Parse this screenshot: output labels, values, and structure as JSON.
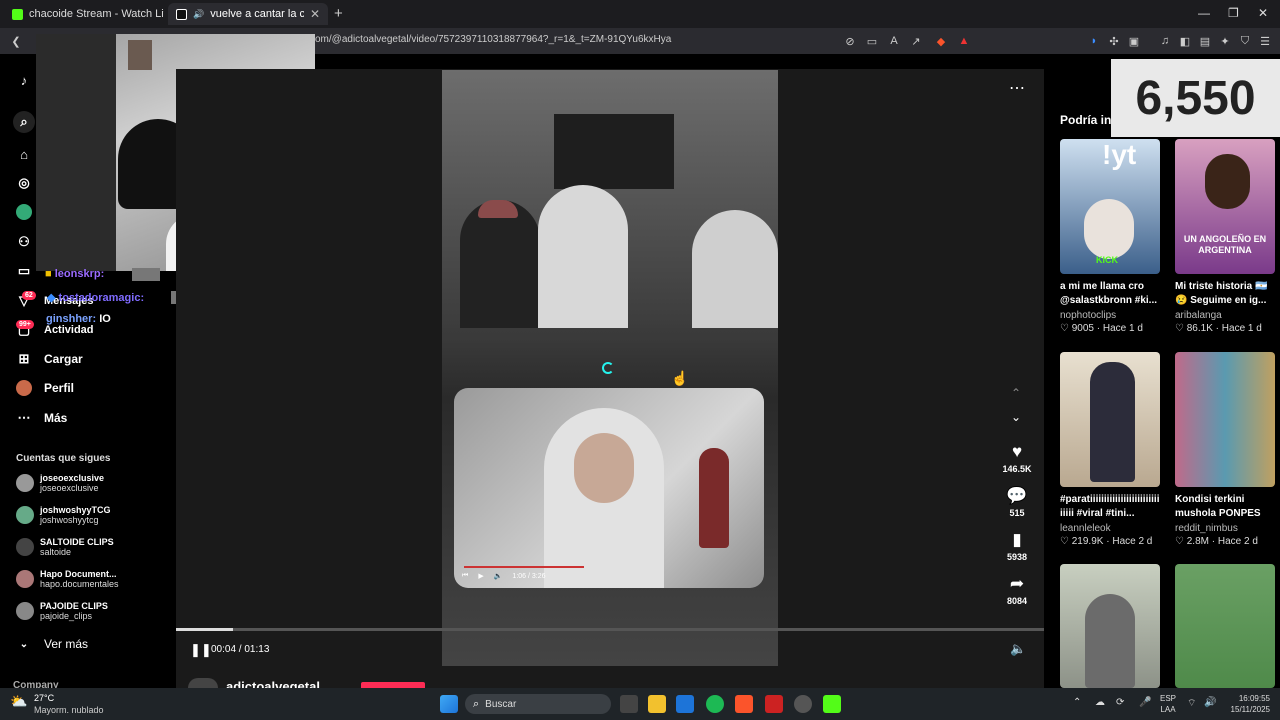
{
  "tabs": [
    {
      "title": "chacoide Stream - Watch Live on",
      "favicon_color": "#53fc18"
    },
    {
      "title": "vuelve a cantar la chica? Jajaj",
      "favicon_color": "#000000"
    }
  ],
  "browser": {
    "url": "om/@adictoalvegetal/video/7572397110318877964?_r=1&_t=ZM-91QYu6kxHya",
    "window_controls": {
      "minimize": "—",
      "maximize": "❐",
      "close": "✕"
    },
    "new_tab": "+"
  },
  "sidebar": {
    "nav": [
      {
        "label": "",
        "icon": "tiktok-logo-icon"
      },
      {
        "label": "",
        "icon": "search-icon"
      },
      {
        "label": "",
        "icon": "home-icon"
      },
      {
        "label": "",
        "icon": "compass-icon"
      },
      {
        "label": "",
        "icon": "following-avatar-icon"
      },
      {
        "label": "",
        "icon": "friends-icon"
      },
      {
        "label": "",
        "icon": "live-icon"
      },
      {
        "label": "Mensajes",
        "icon": "messages-icon",
        "badge": "62"
      },
      {
        "label": "Actividad",
        "icon": "activity-icon",
        "badge": "99+"
      },
      {
        "label": "Cargar",
        "icon": "upload-icon"
      },
      {
        "label": "Perfil",
        "icon": "profile-icon"
      },
      {
        "label": "Más",
        "icon": "more-icon"
      }
    ],
    "following_title": "Cuentas que sigues",
    "following": [
      {
        "name": "joseoexclusive",
        "handle": "joseoexclusive"
      },
      {
        "name": "joshwoshyyTCG",
        "handle": "joshwoshyytcg"
      },
      {
        "name": "SALTOIDE CLIPS",
        "handle": "saltoide"
      },
      {
        "name": "Hapo Document...",
        "handle": "hapo.documentales"
      },
      {
        "name": "PAJOIDE CLIPS",
        "handle": "pajoide_clips"
      }
    ],
    "see_more": "Ver más",
    "company": "Company"
  },
  "chat": [
    {
      "user": "leonskrp:",
      "message": "",
      "color": "#9b6bff"
    },
    {
      "user": "tostadoramagic:",
      "message": "",
      "color": "#7f6bff"
    },
    {
      "user": "ginshher:",
      "message": "IO",
      "color": "#7aa2ff"
    }
  ],
  "video": {
    "time_current": "00:04",
    "time_total": "01:13",
    "progress": 0.066,
    "inner_time": "1:06 / 3:26",
    "author": "adictoalvegetal",
    "actions": [
      {
        "icon": "heart-icon",
        "count": "146.5K"
      },
      {
        "icon": "comment-icon",
        "count": "515"
      },
      {
        "icon": "bookmark-icon",
        "count": "5938"
      },
      {
        "icon": "share-icon",
        "count": "8084"
      }
    ]
  },
  "viewer_count": "6,550",
  "recommend": {
    "title": "Podría in",
    "cards": [
      {
        "title": "a mi me llama cro @salastkbronn #ki...",
        "user": "nophotoclips",
        "likes": "9005",
        "age": "Hace 1 d",
        "overlay": "!yt",
        "color": "#3b5f8a"
      },
      {
        "title": "Mi triste historia 🇦🇷 😢 Seguime en ig...",
        "user": "aribalanga",
        "likes": "86.1K",
        "age": "Hace 1 d",
        "overlay": "UN ANGOLEÑO EN ARGENTINA",
        "color": "#7a3a8a"
      },
      {
        "title": "#paratiiiiiiiiiiiiiiiiiiiiiiiii iiiii #viral #tini...",
        "user": "leannleleok",
        "likes": "219.9K",
        "age": "Hace 2 d",
        "overlay": "",
        "color": "#b9a890"
      },
      {
        "title": "Kondisi terkini mushola PONPES A...",
        "user": "reddit_nimbus",
        "likes": "2.8M",
        "age": "Hace 2 d",
        "overlay": "",
        "color": "#8b6c75"
      },
      {
        "title": "",
        "user": "",
        "likes": "",
        "age": "",
        "overlay": "",
        "color": "#8d9288"
      },
      {
        "title": "",
        "user": "",
        "likes": "",
        "age": "",
        "overlay": "",
        "color": "#4f8a4a"
      }
    ]
  },
  "taskbar": {
    "weather_temp": "27°C",
    "weather_desc": "Mayorm. nublado",
    "search_placeholder": "Buscar",
    "lang": "ESP",
    "lang2": "LAA",
    "time": "16:09:55",
    "date": "15/11/2025"
  }
}
